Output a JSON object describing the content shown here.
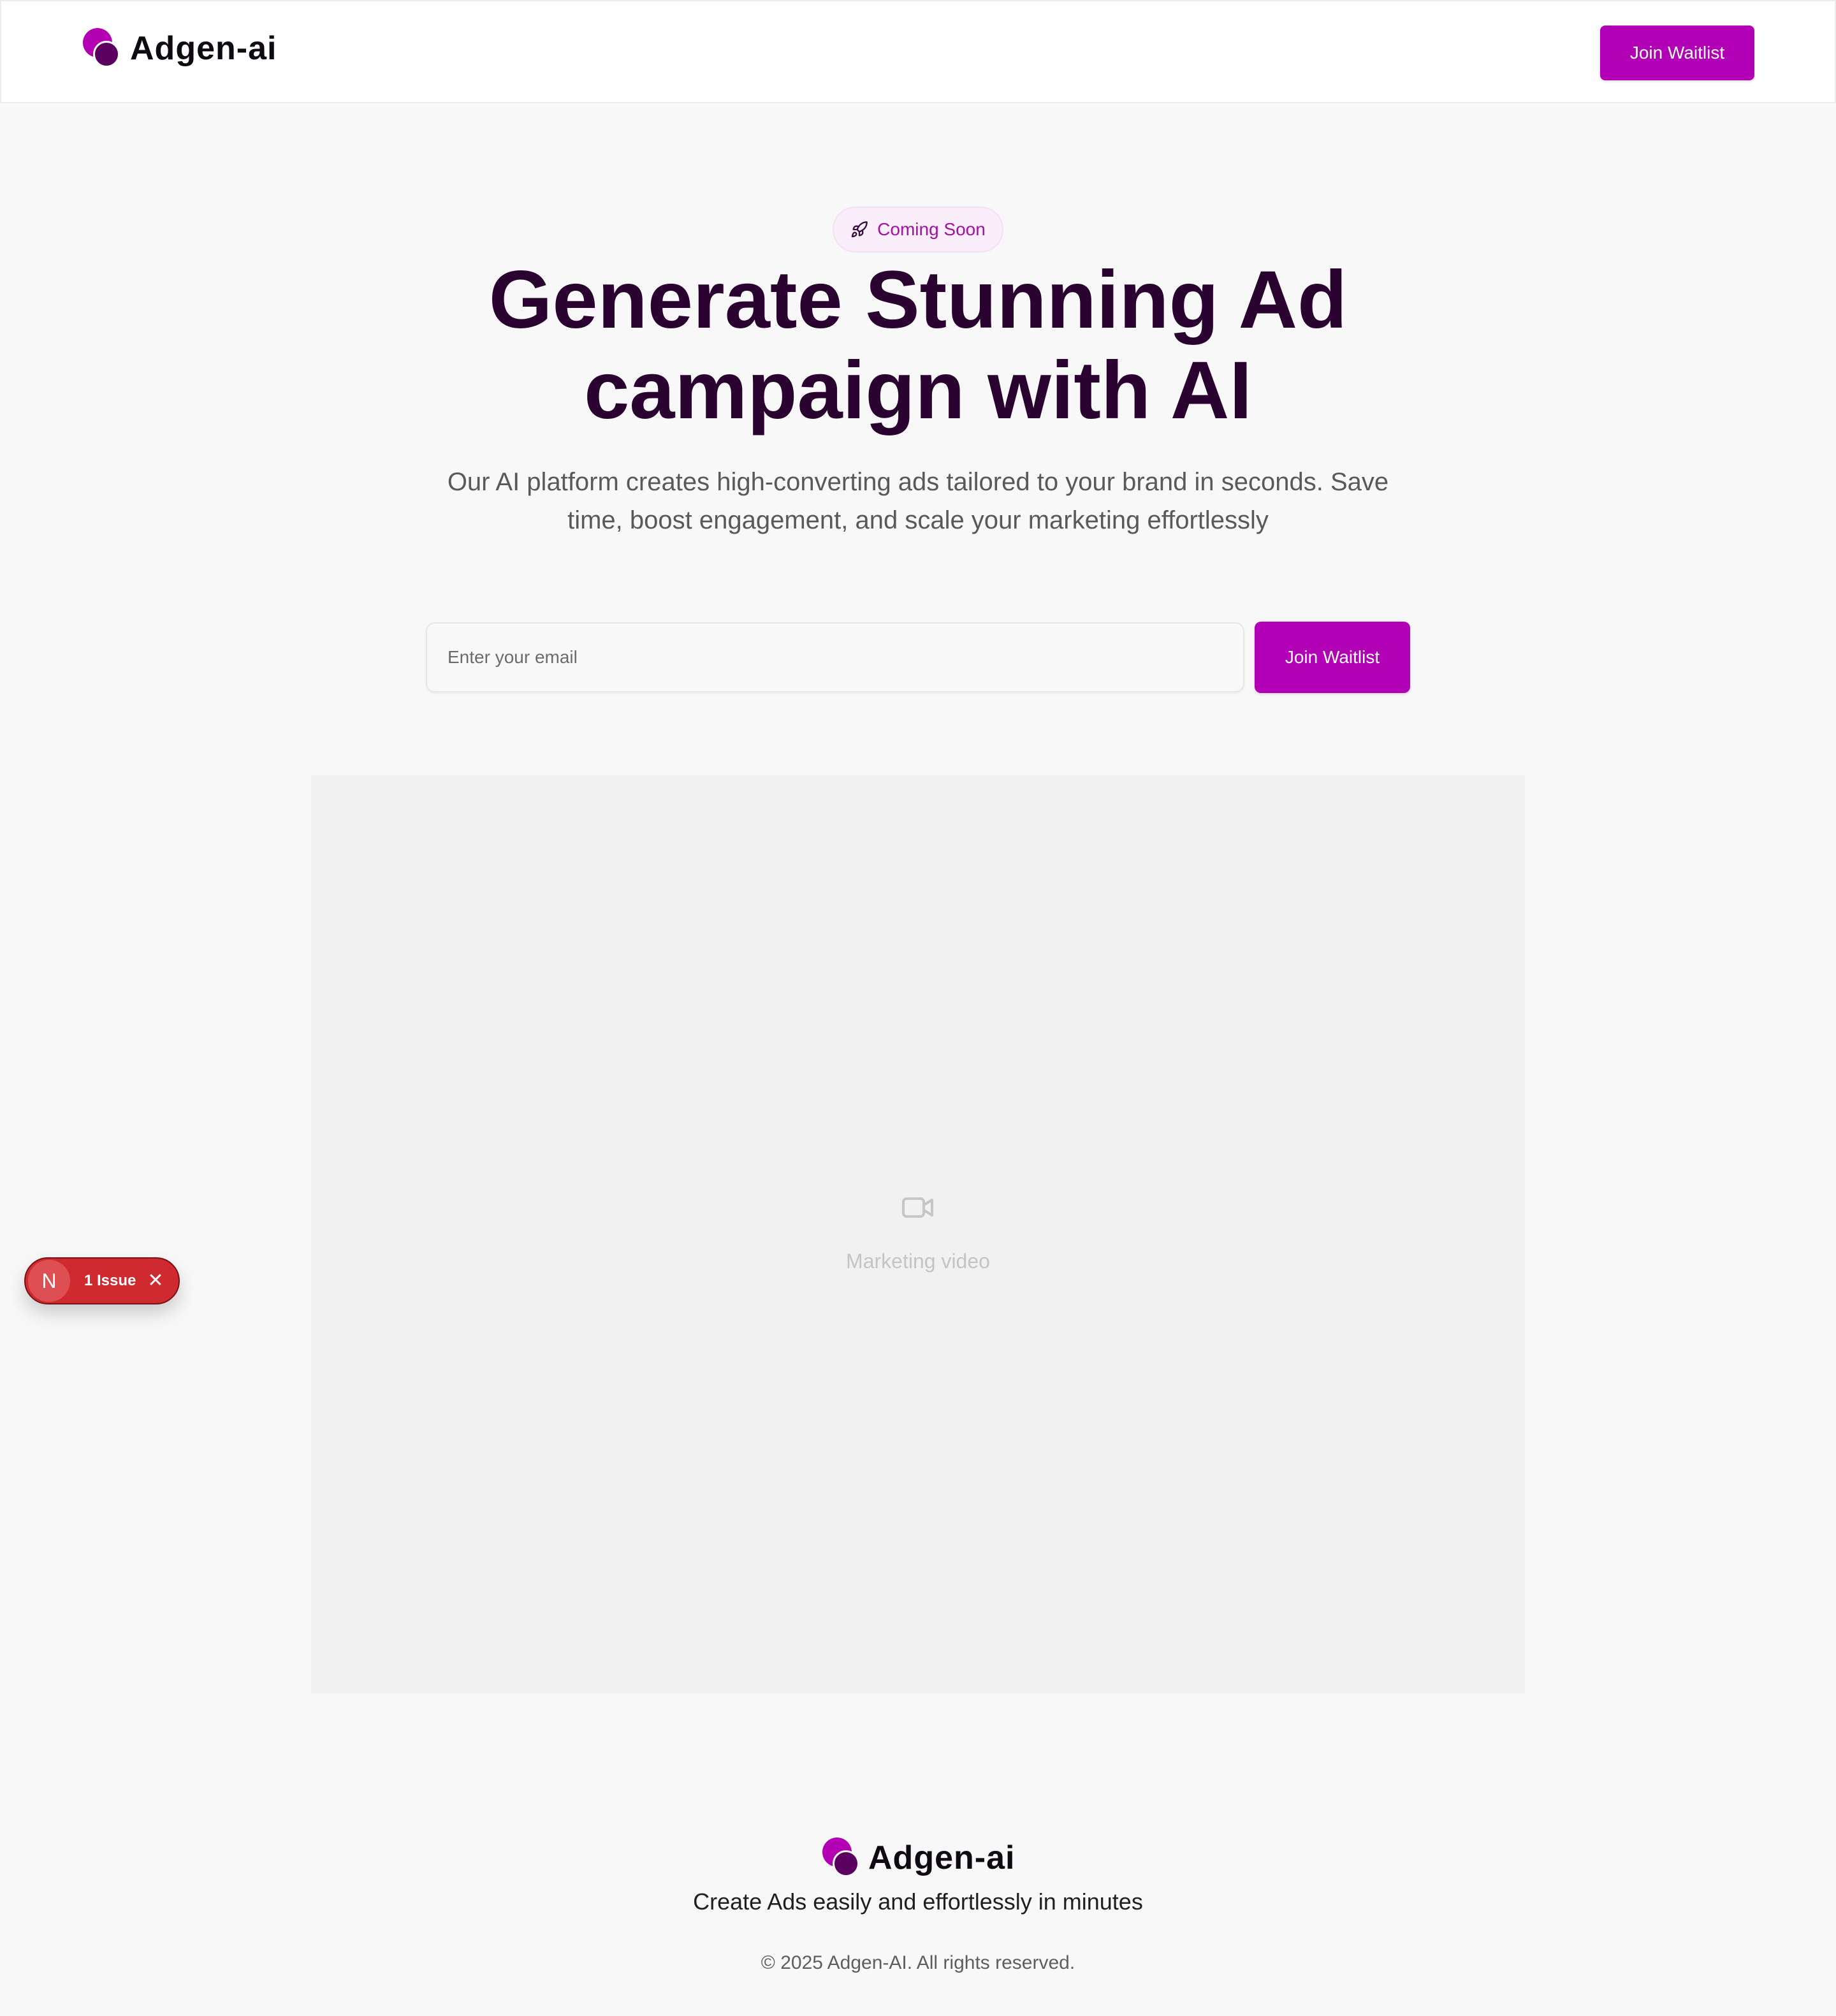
{
  "header": {
    "brand_name": "Adgen-ai",
    "join_label": "Join Waitlist"
  },
  "hero": {
    "badge_label": "Coming Soon",
    "headline_line1": "Generate Stunning Ad",
    "headline_line2": "campaign with AI",
    "subtitle_line1": "Our AI platform creates high-converting ads tailored to your brand in seconds. Save",
    "subtitle_line2": "time, boost engagement, and scale your marketing effortlessly",
    "email_placeholder": "Enter your email",
    "join_label": "Join Waitlist"
  },
  "video": {
    "label": "Marketing video",
    "icon": "video-camera-icon"
  },
  "issue_indicator": {
    "letter": "N",
    "label": "1 Issue"
  },
  "footer": {
    "brand_name": "Adgen-ai",
    "tagline": "Create Ads easily and effortlessly in minutes",
    "copyright": "© 2025 Adgen-AI. All rights reserved."
  },
  "colors": {
    "brand_primary": "#b100b5",
    "brand_dark": "#5b0060",
    "headline": "#2a0331",
    "background": "#f8f8f8",
    "issue_red": "#cf2a2f"
  }
}
